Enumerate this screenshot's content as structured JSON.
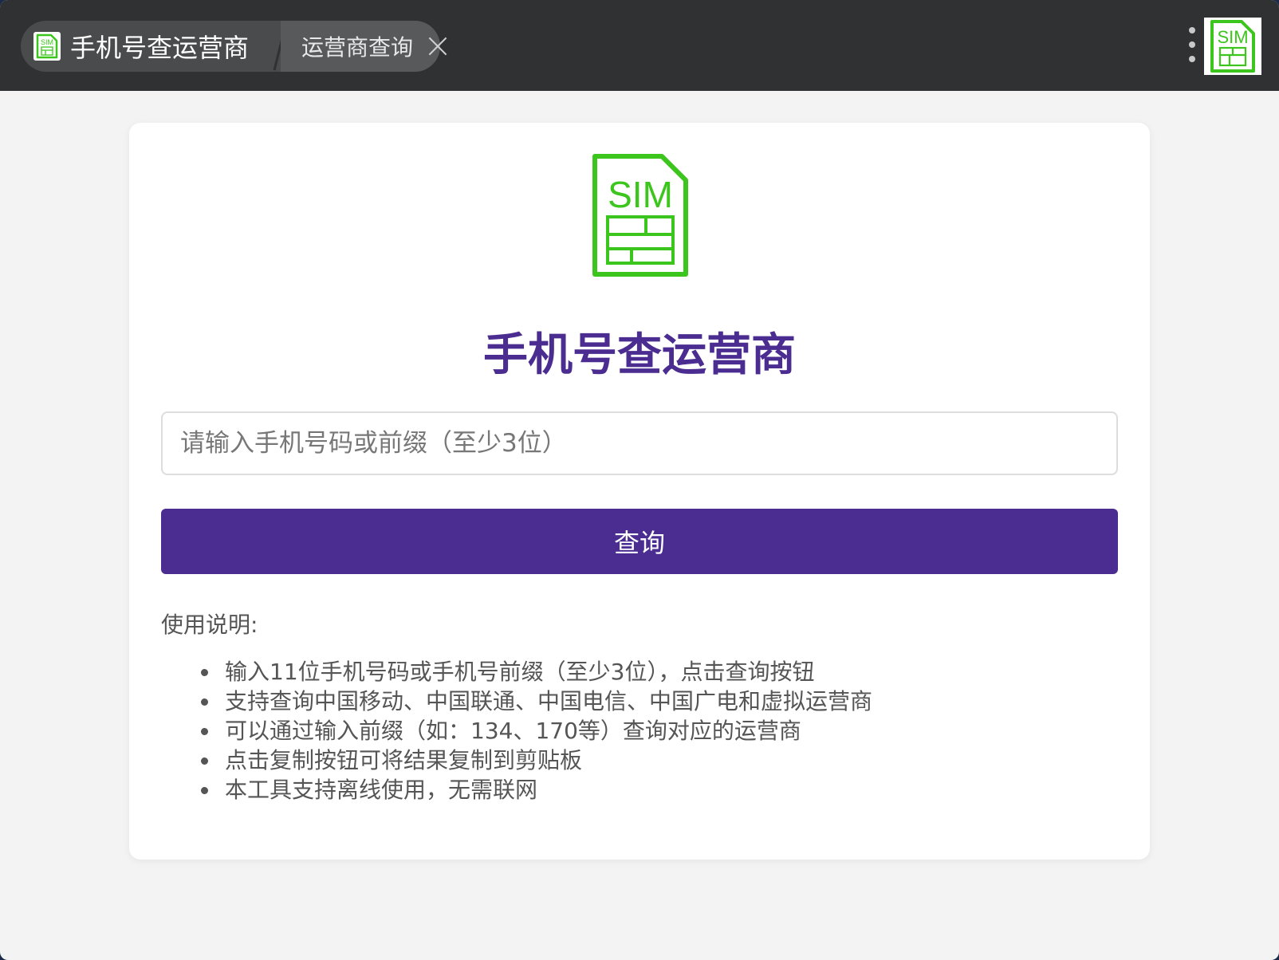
{
  "titlebar": {
    "tab_active_label": "手机号查运营商",
    "tab_second_label": "运营商查询",
    "app_icon_text": "SIM"
  },
  "main": {
    "hero_icon_text": "SIM",
    "title": "手机号查运营商",
    "input_placeholder": "请输入手机号码或前缀（至少3位）",
    "input_value": "",
    "button_label": "查询",
    "instructions_heading": "使用说明:",
    "instructions": [
      "输入11位手机号码或手机号前缀（至少3位），点击查询按钮",
      "支持查询中国移动、中国联通、中国电信、中国广电和虚拟运营商",
      "可以通过输入前缀（如：134、170等）查询对应的运营商",
      "点击复制按钮可将结果复制到剪贴板",
      "本工具支持离线使用，无需联网"
    ]
  },
  "colors": {
    "accent": "#4b2d91",
    "sim_green": "#3cc51c",
    "titlebar_bg": "#303133",
    "page_bg": "#f3f3f3"
  },
  "icons": [
    "sim-card-icon",
    "close-icon",
    "more-vert-icon"
  ]
}
